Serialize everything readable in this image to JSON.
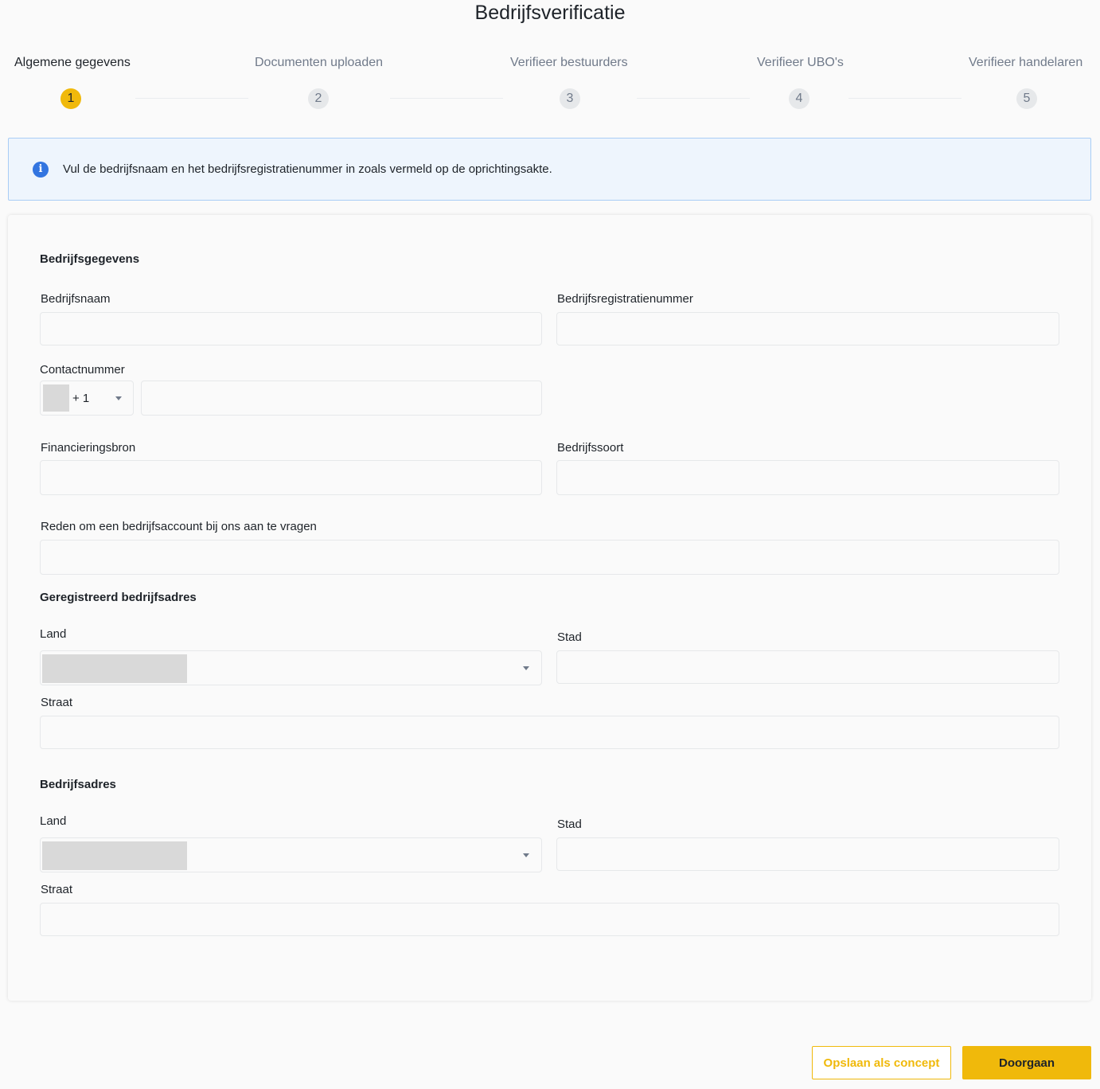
{
  "page": {
    "title": "Bedrijfsverificatie"
  },
  "steps": [
    {
      "number": "1",
      "label": "Algemene gegevens",
      "active": true
    },
    {
      "number": "2",
      "label": "Documenten uploaden",
      "active": false
    },
    {
      "number": "3",
      "label": "Verifieer bestuurders",
      "active": false
    },
    {
      "number": "4",
      "label": "Verifieer UBO's",
      "active": false
    },
    {
      "number": "5",
      "label": "Verifieer handelaren",
      "active": false
    }
  ],
  "info": {
    "text": "Vul de bedrijfsnaam en het bedrijfsregistratienummer in zoals vermeld op de oprichtingsakte.",
    "icon": "info-icon"
  },
  "company": {
    "title": "Bedrijfsgegevens",
    "name_label": "Bedrijfsnaam",
    "name_value": "",
    "reg_label": "Bedrijfsregistratienummer",
    "reg_value": "",
    "contact_label": "Contactnummer",
    "phone_code": "+ 1",
    "phone_value": "",
    "funding_label": "Financieringsbron",
    "funding_value": "",
    "type_label": "Bedrijfssoort",
    "type_value": "",
    "reason_label": "Reden om een bedrijfsaccount bij ons aan te vragen",
    "reason_value": ""
  },
  "registered_address": {
    "title": "Geregistreerd bedrijfsadres",
    "country_label": "Land",
    "city_label": "Stad",
    "street_label": "Straat"
  },
  "business_address": {
    "title": "Bedrijfsadres",
    "country_label": "Land",
    "city_label": "Stad",
    "street_label": "Straat"
  },
  "actions": {
    "save_draft": "Opslaan als concept",
    "continue": "Doorgaan"
  },
  "colors": {
    "accent": "#f0b90b",
    "info_bg": "#eef5fd",
    "info_border": "#a9cdf5",
    "info_icon": "#3375e0"
  }
}
